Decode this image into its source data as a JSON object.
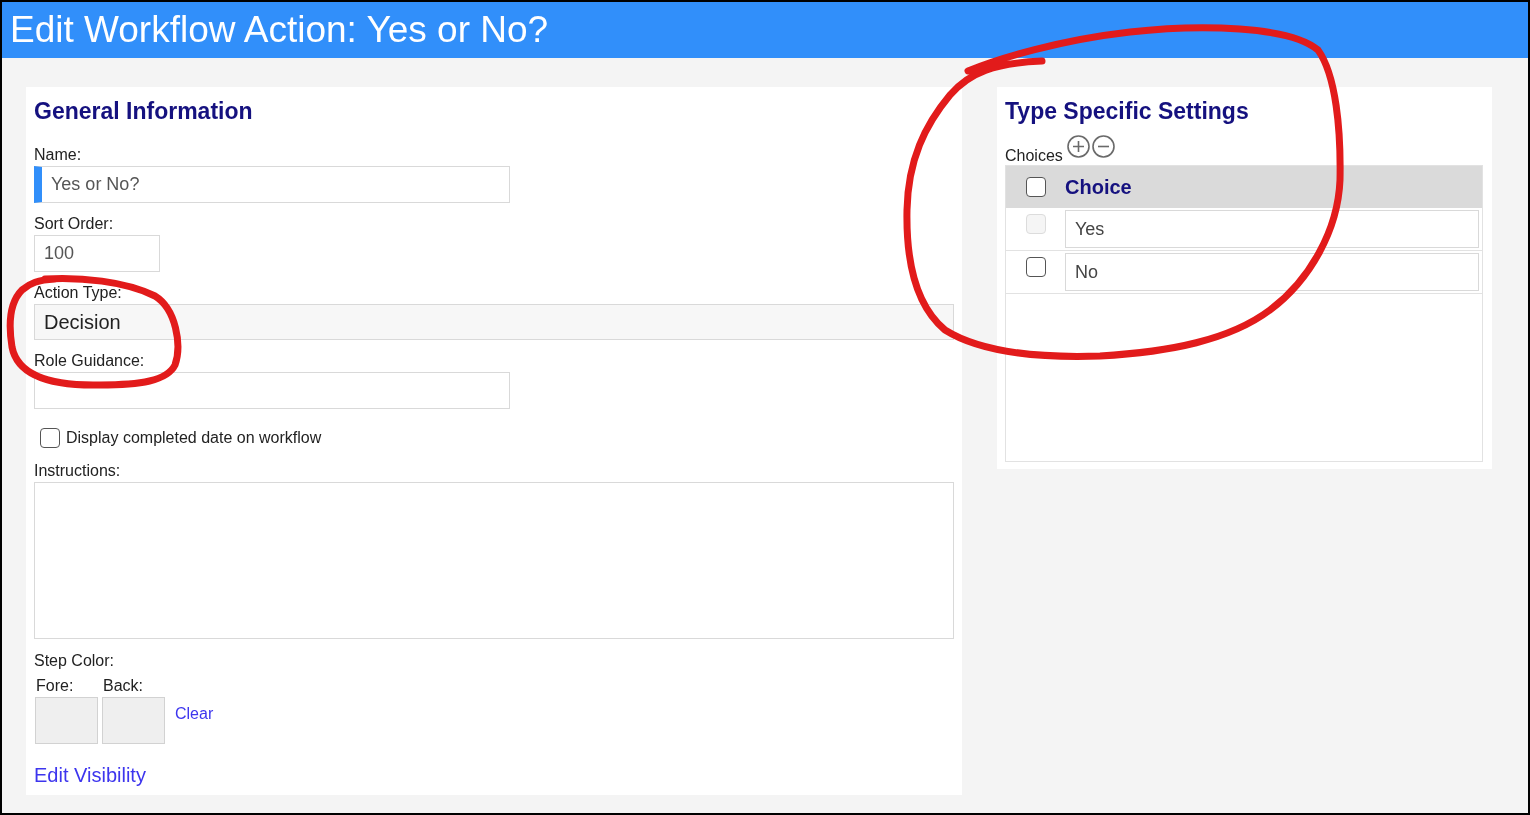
{
  "window": {
    "title": "Edit Workflow Action: Yes or No?"
  },
  "general_information": {
    "heading": "General Information",
    "fields": [
      {
        "kind": "text",
        "label": "Name:",
        "value": "Yes or No?",
        "required": true
      },
      {
        "kind": "number",
        "label": "Sort Order:",
        "value": "100",
        "required": false
      },
      {
        "kind": "static",
        "label": "Action Type:",
        "value": "Decision",
        "required": false
      },
      {
        "kind": "text",
        "label": "Role Guidance:",
        "required": false
      }
    ],
    "display_completed_date": {
      "label": "Display completed date on workflow",
      "checked": false
    },
    "instructions": {
      "label": "Instructions:"
    },
    "step_color": {
      "label": "Step Color:",
      "swatches": [
        {
          "label": "Fore:"
        },
        {
          "label": "Back:"
        }
      ],
      "clear_link": "Clear"
    },
    "edit_visibility_link": "Edit Visibility"
  },
  "type_specific_settings": {
    "heading": "Type Specific Settings",
    "choices_label": "Choices",
    "table": {
      "columns": [
        "Choice"
      ],
      "header_checked": false,
      "rows": [
        {
          "value": "Yes",
          "checked": false,
          "disabled": true
        },
        {
          "value": "No",
          "checked": false,
          "disabled": false
        }
      ]
    }
  }
}
